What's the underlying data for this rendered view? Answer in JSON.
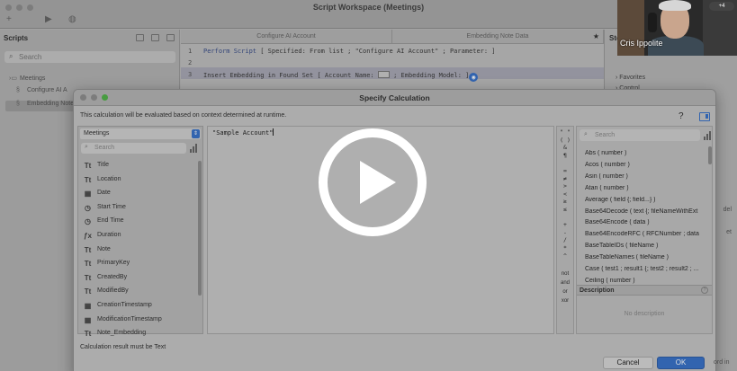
{
  "workspace": {
    "title": "Script Workspace (Meetings)",
    "scripts_heading": "Scripts",
    "search_placeholder": "Search",
    "tree": [
      "Meetings",
      "Configure AI A",
      "Embedding Note"
    ],
    "tabs": [
      "Configure AI Account",
      "Embedding Note Data"
    ],
    "steps_heading": "Ste",
    "code": {
      "lines": [
        "1",
        "2",
        "3"
      ],
      "line1_keyword": "Perform Script",
      "line1_rest": " [ Specified: From list ; \"Configure AI Account\" ; Parameter:   ]",
      "line3_keyword": "Insert Embedding in Found Set",
      "line3_rest_a": " [ Account Name: ",
      "line3_rest_b": " ; Embedding Model:   ]"
    },
    "right_items": [
      "Favorites",
      "Control"
    ],
    "right_edge_texts": [
      "del",
      "et"
    ],
    "footer_fragment": "ord in"
  },
  "webcam": {
    "name": "Cris Ippolite",
    "badge": "+4"
  },
  "dialog": {
    "title": "Specify Calculation",
    "description": "This calculation will be evaluated based on context determined at runtime.",
    "help_label": "?",
    "table_select": "Meetings",
    "field_search_placeholder": "Search",
    "fields": [
      {
        "icon": "Tt",
        "label": "Title"
      },
      {
        "icon": "Tt",
        "label": "Location"
      },
      {
        "icon": "▦",
        "label": "Date"
      },
      {
        "icon": "◷",
        "label": "Start Time"
      },
      {
        "icon": "◷",
        "label": "End Time"
      },
      {
        "icon": "ƒx",
        "label": "Duration"
      },
      {
        "icon": "Tt",
        "label": "Note"
      },
      {
        "icon": "Tt",
        "label": "PrimaryKey"
      },
      {
        "icon": "Tt",
        "label": "CreatedBy"
      },
      {
        "icon": "Tt",
        "label": "ModifiedBy"
      },
      {
        "icon": "▦",
        "label": "CreationTimestamp"
      },
      {
        "icon": "▦",
        "label": "ModificationTimestamp"
      },
      {
        "icon": "Tt",
        "label": "Note_Embedding"
      }
    ],
    "formula": "\"Sample Account\"",
    "operators": [
      "\" \"",
      "( )",
      "&",
      "¶",
      "",
      "=",
      "≠",
      ">",
      "<",
      "≥",
      "≤",
      "",
      "+",
      "-",
      "/",
      "*",
      "^"
    ],
    "operator_words": [
      "not",
      "and",
      "or",
      "xor"
    ],
    "function_search_placeholder": "Search",
    "functions": [
      "Abs ( number )",
      "Acos ( number )",
      "Asin ( number )",
      "Atan ( number )",
      "Average ( field {; field...} )",
      "Base64Decode ( text {; fileNameWithExt",
      "Base64Encode ( data )",
      "Base64EncodeRFC ( RFCNumber ; data",
      "BaseTableIDs ( fileName )",
      "BaseTableNames ( fileName )",
      "Case ( test1 ; result1 {; test2 ; result2 ; ...",
      "Ceiling ( number )"
    ],
    "description_heading": "Description",
    "description_empty": "No description",
    "result_type": "Calculation result must be  Text",
    "cancel_label": "Cancel",
    "ok_label": "OK"
  },
  "video": {
    "play_icon": "play-icon"
  }
}
